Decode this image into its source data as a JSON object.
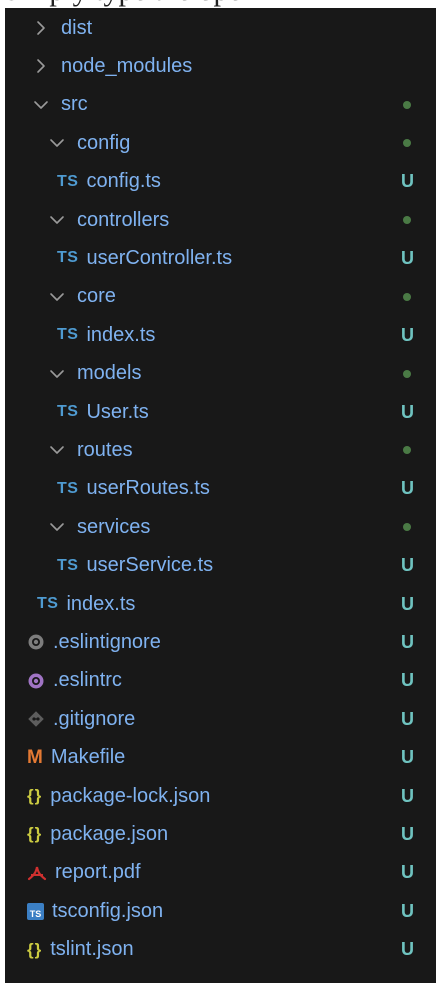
{
  "partial_heading": "simply type the open",
  "colors": {
    "background": "#181818",
    "folder_text": "#7fb2f0",
    "ignored_text": "#8b8b8b",
    "untracked_badge": "#6fc3c0",
    "modified_dot": "#4a7a45",
    "ts_icon": "#4f9bd1",
    "makefile_icon": "#e37933",
    "json_icon": "#cbcb41",
    "eslint_icon": "#a074c4",
    "pdf_icon": "#d0302f"
  },
  "tree": [
    {
      "label": "dist",
      "kind": "folder",
      "expanded": false,
      "icon": "chevron-right-icon",
      "status": "ignored"
    },
    {
      "label": "node_modules",
      "kind": "folder",
      "expanded": false,
      "icon": "chevron-right-icon",
      "status": "ignored"
    },
    {
      "label": "src",
      "kind": "folder",
      "expanded": true,
      "icon": "chevron-down-icon",
      "status": "dot"
    },
    {
      "label": "config",
      "kind": "folder",
      "expanded": true,
      "icon": "chevron-down-icon",
      "status": "dot"
    },
    {
      "label": "config.ts",
      "kind": "file",
      "icon": "typescript-icon",
      "icon_text": "TS",
      "status": "U"
    },
    {
      "label": "controllers",
      "kind": "folder",
      "expanded": true,
      "icon": "chevron-down-icon",
      "status": "dot"
    },
    {
      "label": "userController.ts",
      "kind": "file",
      "icon": "typescript-icon",
      "icon_text": "TS",
      "status": "U"
    },
    {
      "label": "core",
      "kind": "folder",
      "expanded": true,
      "icon": "chevron-down-icon",
      "status": "dot"
    },
    {
      "label": "index.ts",
      "kind": "file",
      "icon": "typescript-icon",
      "icon_text": "TS",
      "status": "U"
    },
    {
      "label": "models",
      "kind": "folder",
      "expanded": true,
      "icon": "chevron-down-icon",
      "status": "dot"
    },
    {
      "label": "User.ts",
      "kind": "file",
      "icon": "typescript-icon",
      "icon_text": "TS",
      "status": "U"
    },
    {
      "label": "routes",
      "kind": "folder",
      "expanded": true,
      "icon": "chevron-down-icon",
      "status": "dot"
    },
    {
      "label": "userRoutes.ts",
      "kind": "file",
      "icon": "typescript-icon",
      "icon_text": "TS",
      "status": "U"
    },
    {
      "label": "services",
      "kind": "folder",
      "expanded": true,
      "icon": "chevron-down-icon",
      "status": "dot"
    },
    {
      "label": "userService.ts",
      "kind": "file",
      "icon": "typescript-icon",
      "icon_text": "TS",
      "status": "U"
    },
    {
      "label": "index.ts",
      "kind": "file",
      "icon": "typescript-icon",
      "icon_text": "TS",
      "status": "U"
    },
    {
      "label": ".eslintignore",
      "kind": "file",
      "icon": "eslintignore-icon",
      "status": "U"
    },
    {
      "label": ".eslintrc",
      "kind": "file",
      "icon": "eslint-icon",
      "status": "U"
    },
    {
      "label": ".gitignore",
      "kind": "file",
      "icon": "git-icon",
      "status": "U"
    },
    {
      "label": "Makefile",
      "kind": "file",
      "icon": "makefile-icon",
      "icon_text": "M",
      "status": "U"
    },
    {
      "label": "package-lock.json",
      "kind": "file",
      "icon": "json-icon",
      "icon_text": "{}",
      "status": "U"
    },
    {
      "label": "package.json",
      "kind": "file",
      "icon": "json-icon",
      "icon_text": "{}",
      "status": "U"
    },
    {
      "label": "report.pdf",
      "kind": "file",
      "icon": "pdf-icon",
      "status": "U"
    },
    {
      "label": "tsconfig.json",
      "kind": "file",
      "icon": "tsconfig-icon",
      "icon_text": "TS",
      "status": "U"
    },
    {
      "label": "tslint.json",
      "kind": "file",
      "icon": "json-icon",
      "icon_text": "{}",
      "status": "U"
    }
  ]
}
